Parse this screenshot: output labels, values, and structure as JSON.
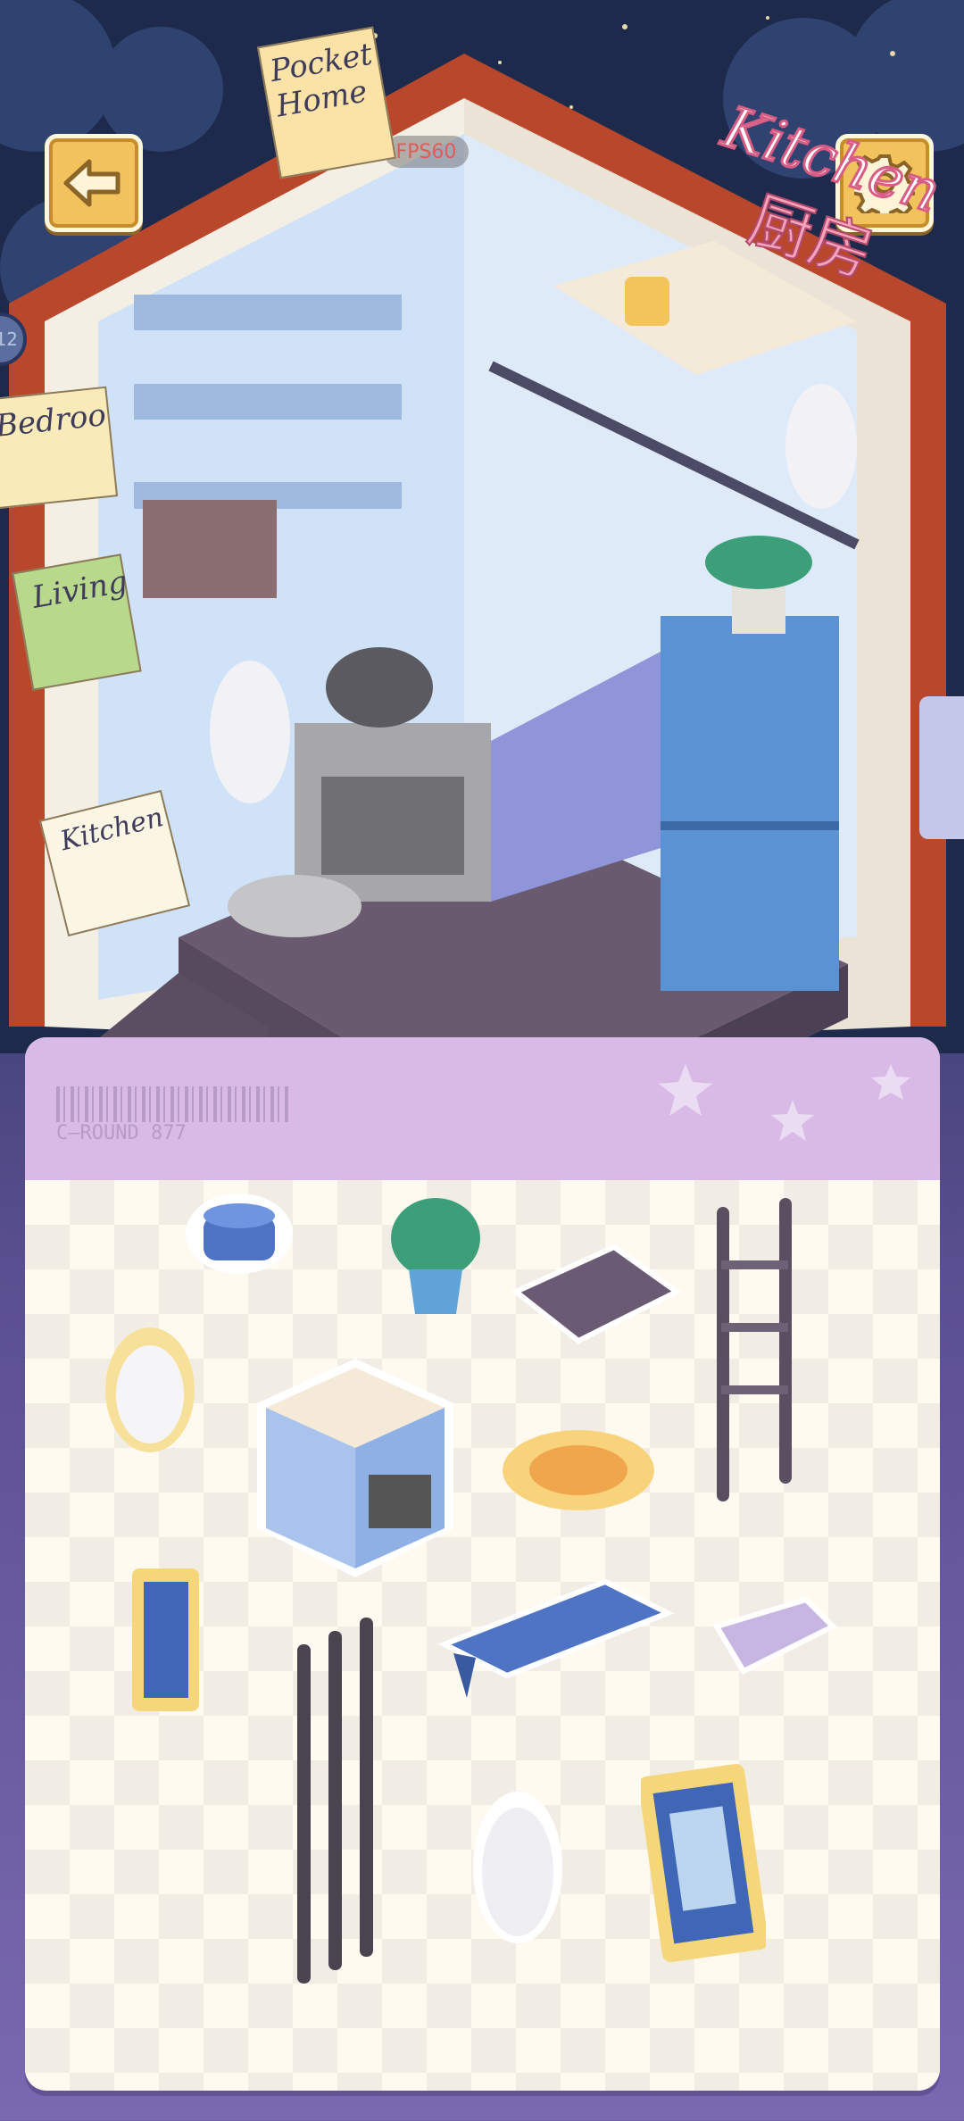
{
  "hud": {
    "fps_label": "FPS60",
    "back_icon": "arrow-left-icon",
    "settings_icon": "gear-icon",
    "side_counter": "12"
  },
  "signs": {
    "pocket_home": "Pocket Home",
    "room_title_en": "Kitchen",
    "room_title_zh": "厨房",
    "tab_bedroom": "Bedroo",
    "tab_living": "Living",
    "tab_kitchen": "Kitchen"
  },
  "tray": {
    "barcode_text": "C—ROUND 877",
    "items": [
      {
        "name": "blue-pot-sticker"
      },
      {
        "name": "potted-plant-sticker"
      },
      {
        "name": "stove-mat-sticker"
      },
      {
        "name": "ladder-sticker"
      },
      {
        "name": "bunny-sticker"
      },
      {
        "name": "stove-oven-sticker"
      },
      {
        "name": "flower-rug-sticker"
      },
      {
        "name": "small-frame-sticker"
      },
      {
        "name": "poles-sticker"
      },
      {
        "name": "shelf-board-sticker"
      },
      {
        "name": "basket-sticker"
      },
      {
        "name": "hanging-bunny-sticker"
      },
      {
        "name": "cat-picture-sticker"
      }
    ]
  },
  "colors": {
    "button_gold": "#f2c35c",
    "tray_header": "#d9b9e6",
    "floor": "#6a5a70",
    "wall_blue": "#cfe2f8"
  }
}
